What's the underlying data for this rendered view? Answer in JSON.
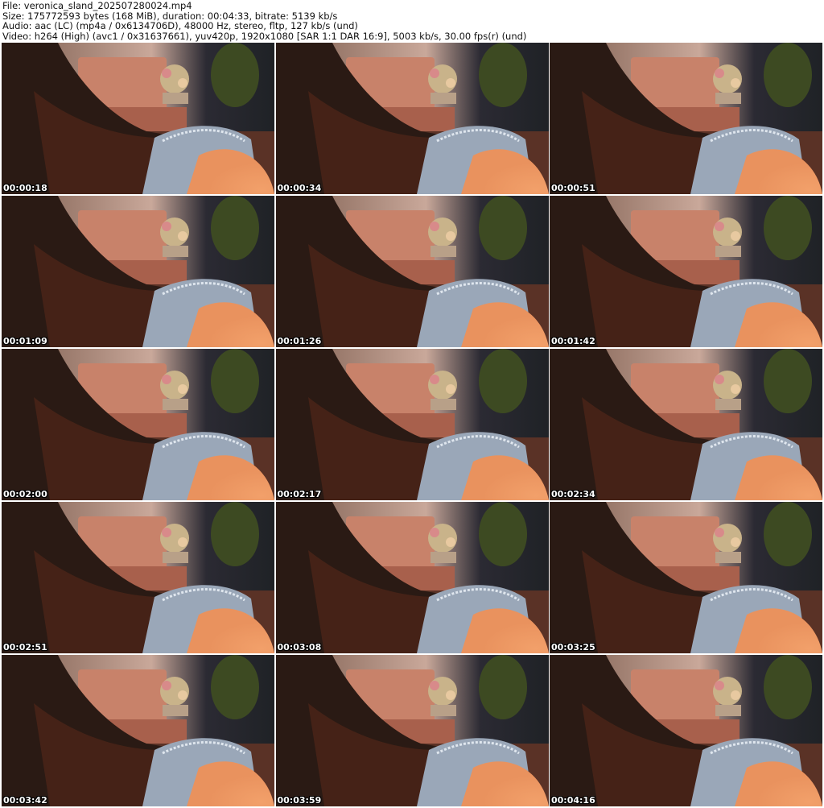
{
  "header": {
    "file_line": "File: veronica_sland_202507280024.mp4",
    "size_line": "Size: 175772593 bytes (168 MiB), duration: 00:04:33, bitrate: 5139 kb/s",
    "audio_line": "Audio: aac (LC) (mp4a / 0x6134706D), 48000 Hz, stereo, fltp, 127 kb/s (und)",
    "video_line": "Video: h264 (High) (avc1 / 0x31637661), yuv420p, 1920x1080 [SAR 1:1 DAR 16:9], 5003 kb/s, 30.00 fps(r) (und)"
  },
  "thumbnails": [
    {
      "timestamp": "00:00:18"
    },
    {
      "timestamp": "00:00:34"
    },
    {
      "timestamp": "00:00:51"
    },
    {
      "timestamp": "00:01:09"
    },
    {
      "timestamp": "00:01:26"
    },
    {
      "timestamp": "00:01:42"
    },
    {
      "timestamp": "00:02:00"
    },
    {
      "timestamp": "00:02:17"
    },
    {
      "timestamp": "00:02:34"
    },
    {
      "timestamp": "00:02:51"
    },
    {
      "timestamp": "00:03:08"
    },
    {
      "timestamp": "00:03:25"
    },
    {
      "timestamp": "00:03:42"
    },
    {
      "timestamp": "00:03:59"
    },
    {
      "timestamp": "00:04:16"
    }
  ],
  "colors": {
    "wall": "#c9a89a",
    "sofa": "#c8826a",
    "hair": "#2a1a14",
    "denim": "#9aa7b8",
    "skin": "#e9925e",
    "plant": "#3d4a22",
    "heart": "#e0306a"
  }
}
